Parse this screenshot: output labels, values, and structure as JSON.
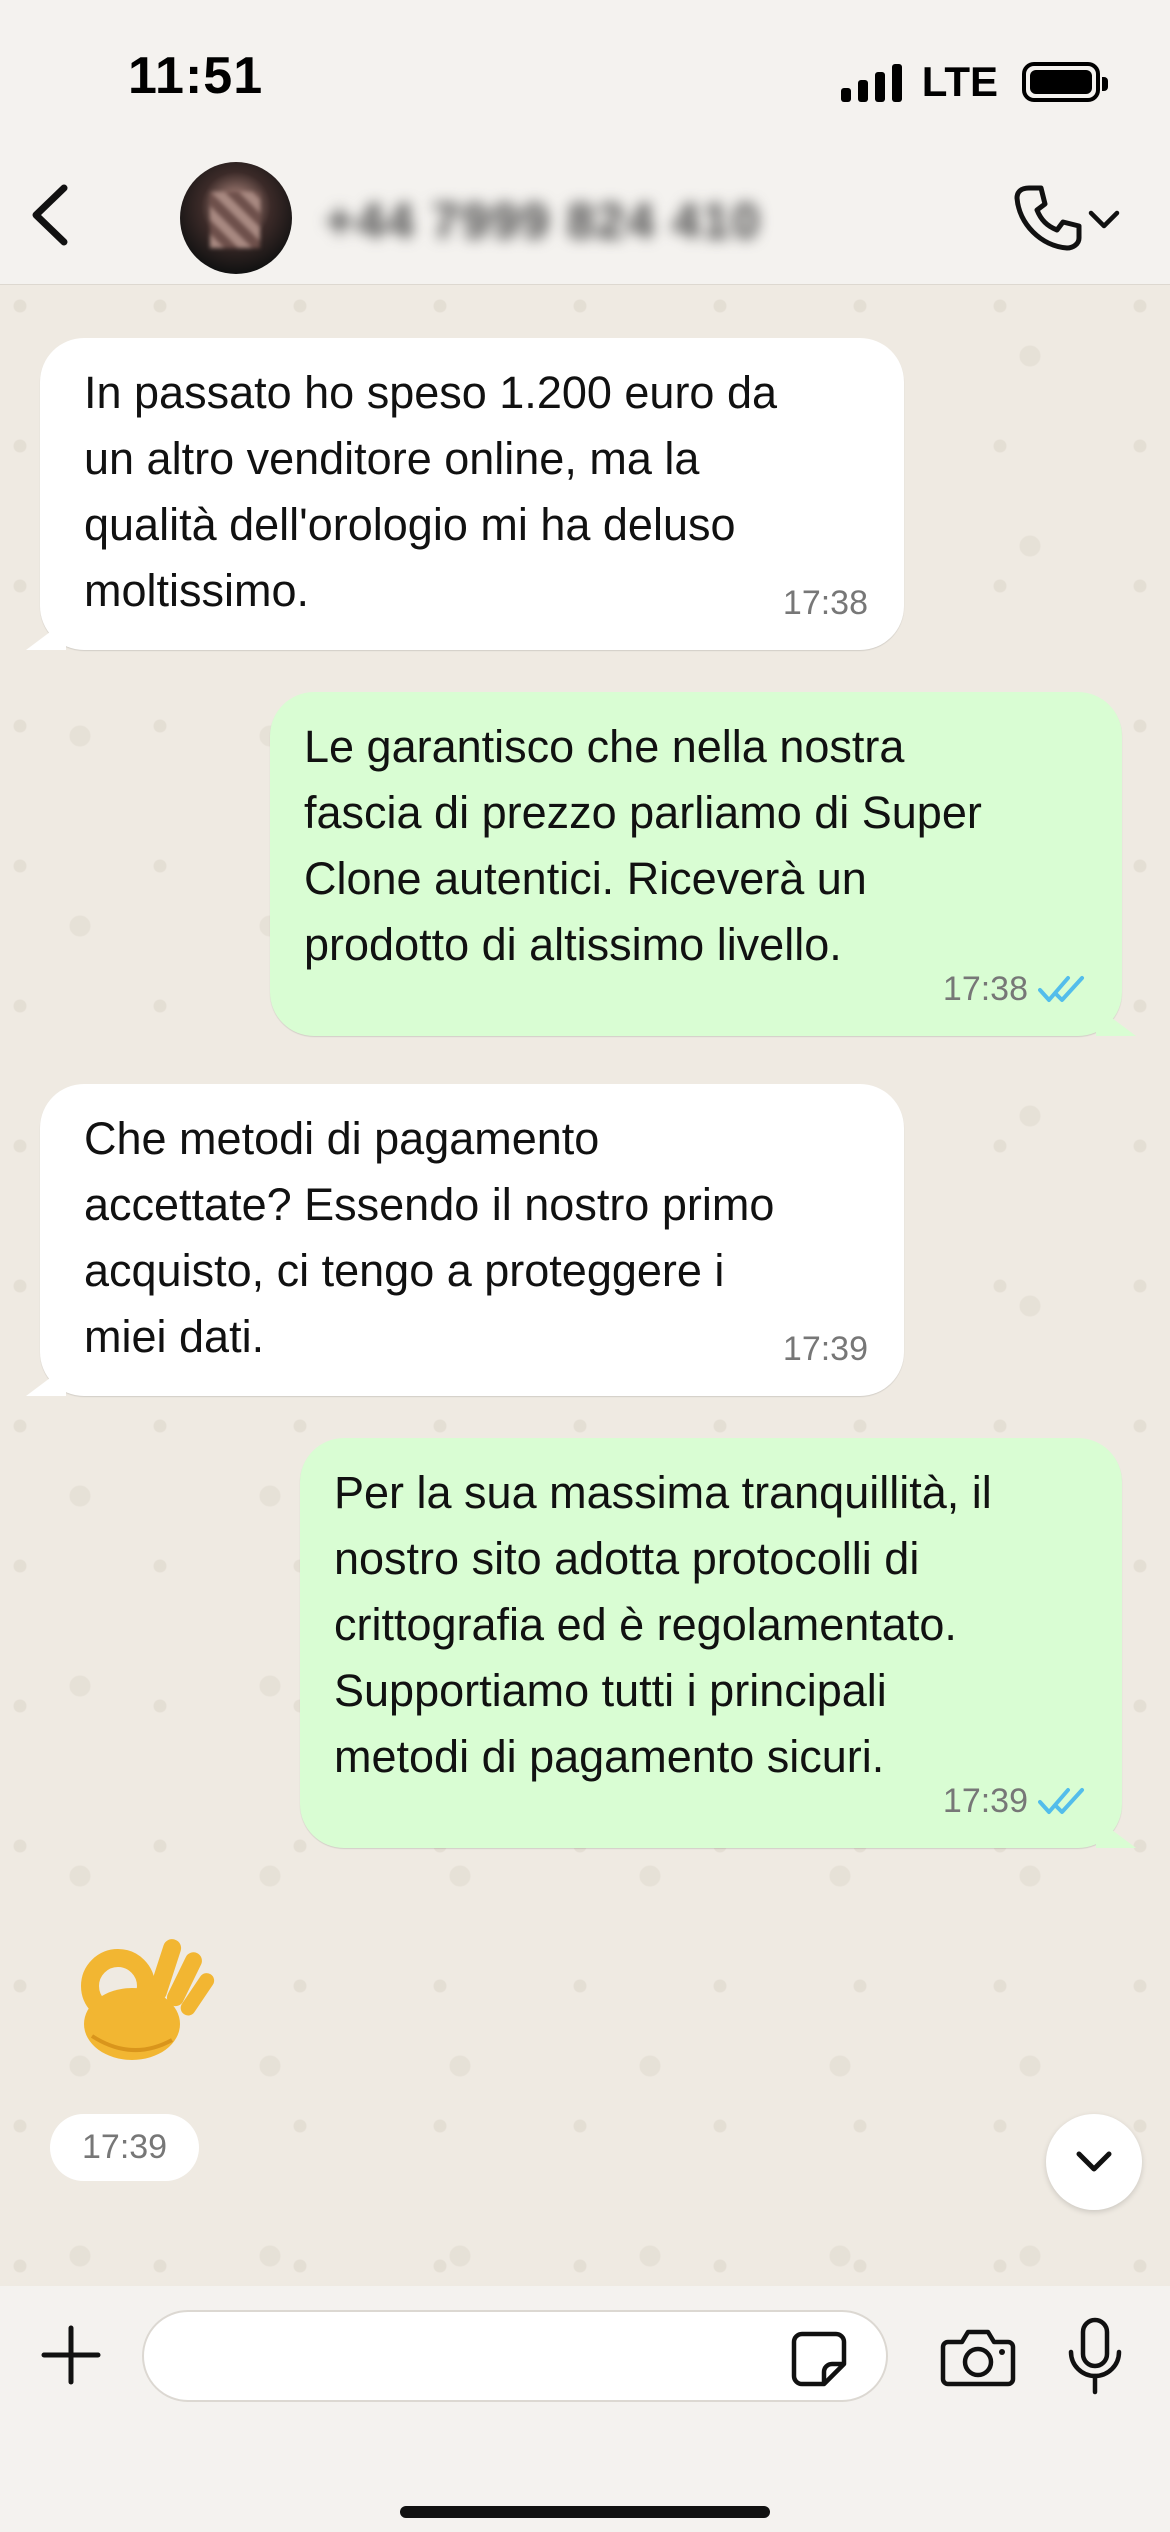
{
  "status_bar": {
    "time": "11:51",
    "network": "LTE",
    "battery_level": 1.0
  },
  "header": {
    "contact_name": "+44 7999 824 410",
    "icons": [
      "back-chevron-icon",
      "avatar",
      "phone-call-icon",
      "chevron-down-icon"
    ]
  },
  "messages": [
    {
      "direction": "incoming",
      "text": "In passato ho speso 1.200 euro da\nun altro venditore online, ma la\nqualità dell'orologio mi ha deluso\nmoltissimo.",
      "time": "17:38"
    },
    {
      "direction": "outgoing",
      "text": "Le garantisco che nella nostra\nfascia di prezzo parliamo di Super\nClone autentici. Riceverà un\nprodotto di altissimo livello.",
      "time": "17:38",
      "status": "read"
    },
    {
      "direction": "incoming",
      "text": "Che metodi di pagamento\naccettate? Essendo il nostro primo\nacquisto, ci tengo a proteggere i\nmiei dati.",
      "time": "17:39"
    },
    {
      "direction": "outgoing",
      "text": "Per la sua massima tranquillità, il\nnostro sito adotta protocolli di\ncrittografia ed è regolamentato.\nSupportiamo tutti i principali\nmetodi di pagamento sicuri.",
      "time": "17:39",
      "status": "read"
    },
    {
      "direction": "incoming",
      "emoji": "👌",
      "time": "17:39"
    }
  ],
  "input_bar": {
    "placeholder": "",
    "icons": [
      "plus-icon",
      "sticker-icon",
      "camera-icon",
      "microphone-icon"
    ]
  },
  "colors": {
    "incoming_bubble": "#ffffff",
    "outgoing_bubble": "#d9fdd3",
    "chat_background": "#efeae2",
    "read_ticks": "#53bdeb"
  }
}
